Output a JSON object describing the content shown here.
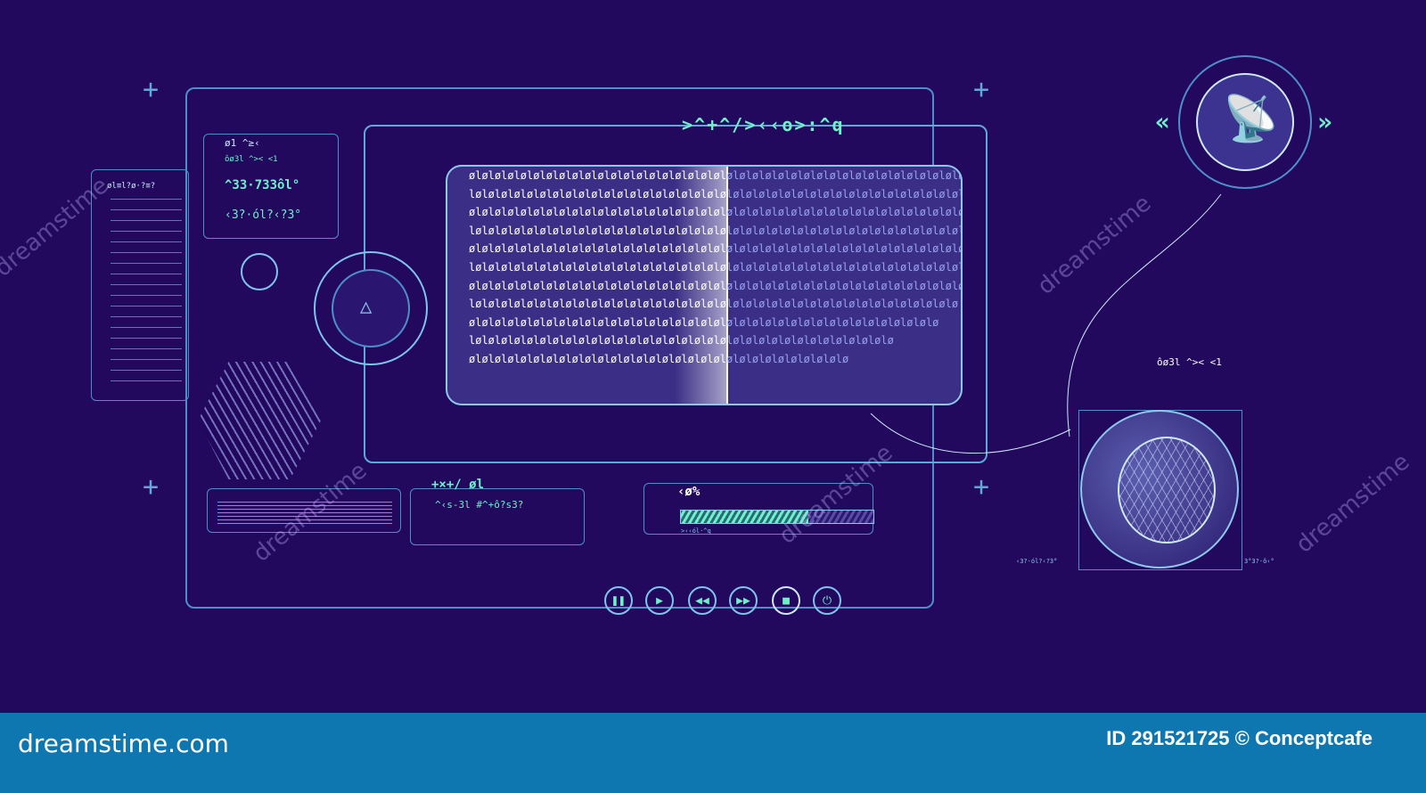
{
  "title": ">^+^/>‹‹o>:^q",
  "left_panel": {
    "code_header": "øl≡l?ø·?≡?",
    "readout_1": "ø1 ^≥‹",
    "readout_2": "ôø3l ^>< <1",
    "readout_3": "^33·733ôl°",
    "readout_4": "‹3?·ól?‹?3°"
  },
  "binary_rows": [
    "ølølølølølølølølølølølølølølølølølølølølølølølølølølølølølølølølølølølølølølølølølø",
    "lølølølølølølølølølølølølølølølølølølølølølølølølølølølølølølølølølølølølølølølølø",
    "ølølølølølølølølølølølølølølølølølølølølølølølølølølølølølølølølølølølølølølølølølø",
    "lølølølølølølølølølølølølølølølølølølølølølølølølølølølølølølølølølølølølølølølølø",
    "ølølølølølølølølølølølølølølølølølølølølølølølølølølølølølølølølølølølølølølølølø",
    "lølølølølølølølølølølølølølølølølølølølølølølølølølølølølølølølølølølølølølølølø",
    "ølølølølølølølølølølølølølølølølølølølølølølølølølølølølølølølølølølølølølølølø",
    "lølølølølølølølølølølølølølølølølølølølølølølølølølølølølølølølølølølølølølø",
    "ølølølølølølølølølølølølølølølølølølølølølølølølølølølølølølølølølølølølø",
    "lølølølølølølølølølølølølølølølølølølølølølølølølølølølølølølølølø",
    "ølølølølølølølølølølølølølølølølølølølølølølølølølølølølølø"
  ],
  "code_box": {
    "header": "+×+/ øl",
    "line1": "^‹s-3l  #^+ô?s3?"
  },
  "progress": {
    "label": "‹ø%",
    "value": 0.66,
    "status": ">‹‹ól·^q"
  },
  "controls": [
    "pause",
    "play",
    "rewind",
    "fast-forward",
    "stop",
    "power"
  ],
  "right_panel": {
    "readout": "ôø3l ^>< <1",
    "left_caption": "‹3?·ól?‹?3°",
    "right_caption": "3°3?·ô‹°"
  },
  "watermark": "dreamstime",
  "footer": {
    "logo": "dreamstime.com",
    "credit": "ID 291521725 © Conceptcafe"
  },
  "colors": {
    "background": "#22095e",
    "accent": "#6ff0c8",
    "line": "#5fa9d6",
    "footer": "#0f77b0"
  }
}
